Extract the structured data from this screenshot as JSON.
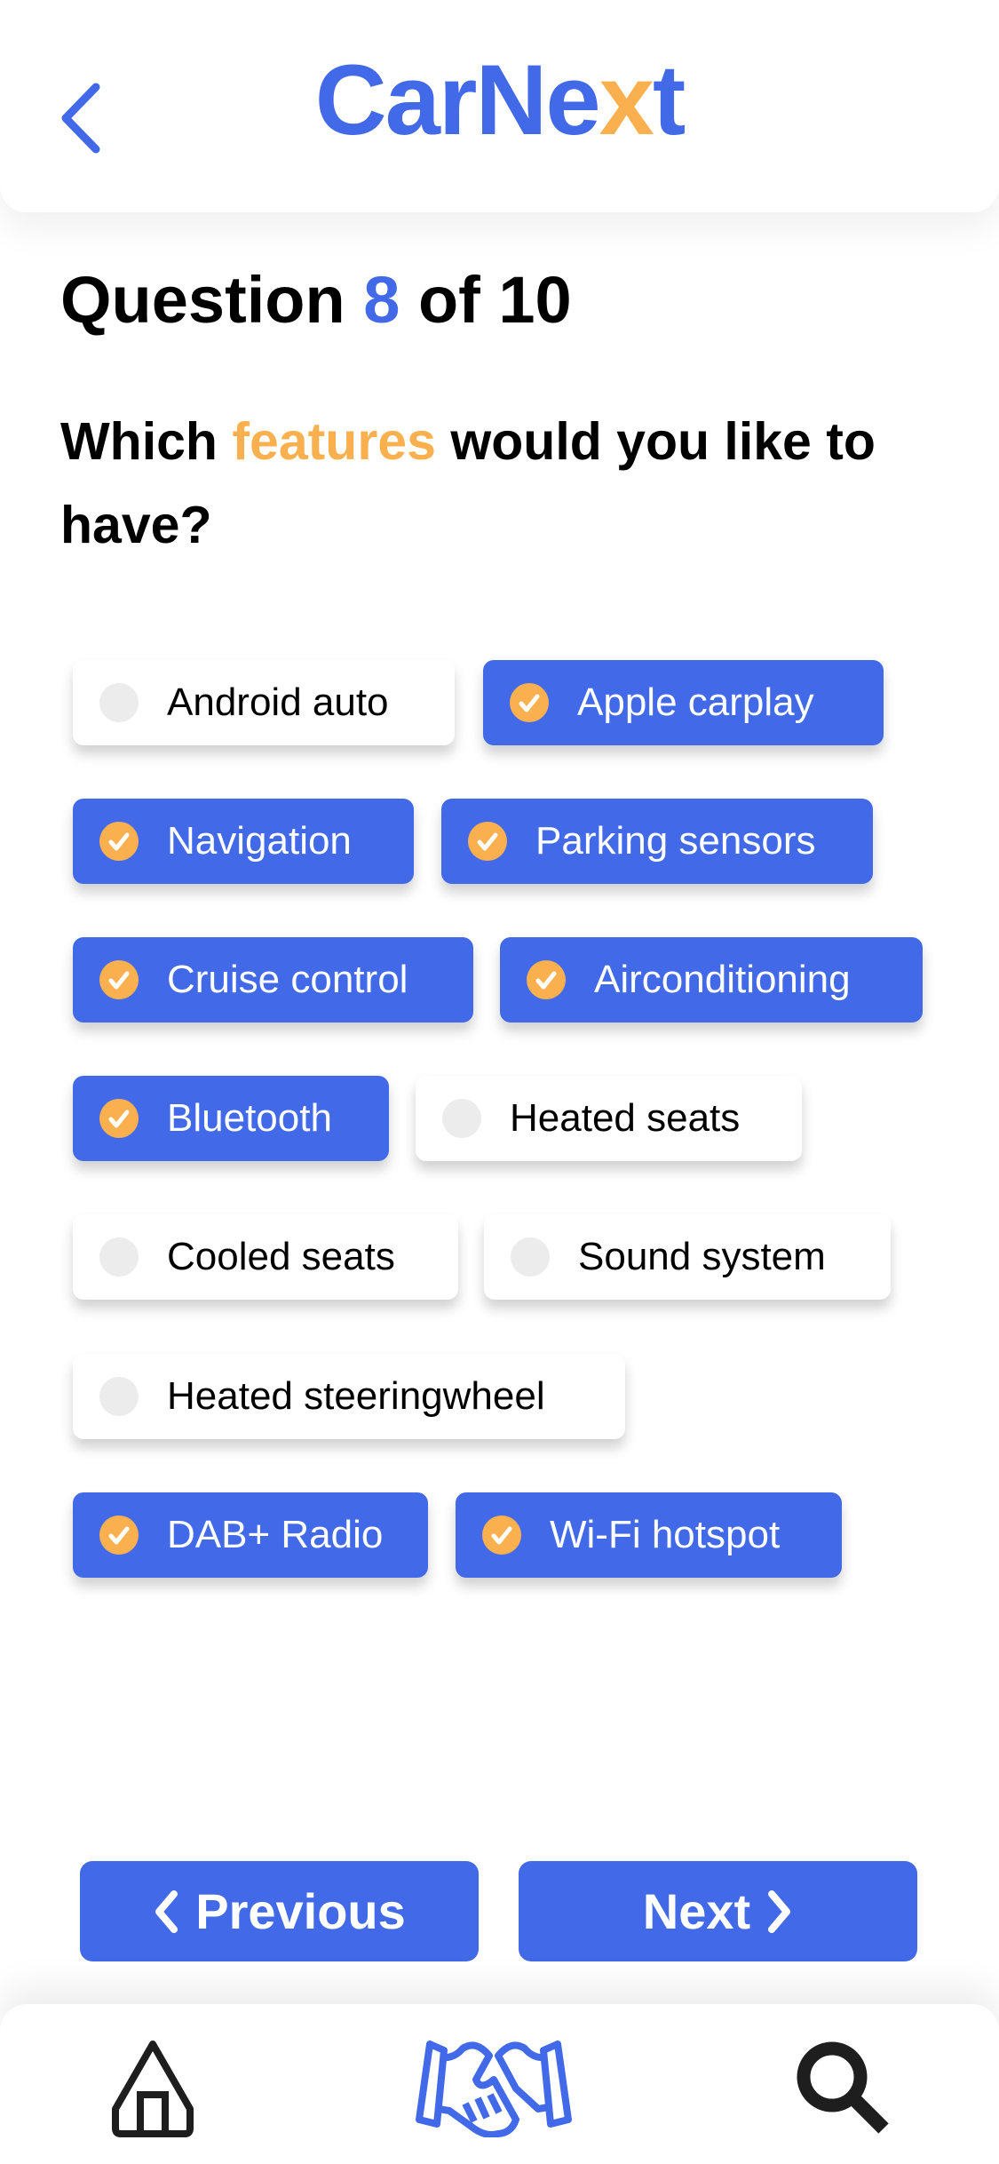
{
  "header": {
    "logo_main": "CarNe",
    "logo_x": "x",
    "logo_end": "t",
    "back_icon": "chevron-left-icon"
  },
  "question": {
    "prefix": "Question",
    "current": "8",
    "middle": "of",
    "total": "10"
  },
  "prompt": {
    "before": "Which",
    "highlight": "features",
    "after": "would you like to have?"
  },
  "options": [
    {
      "label": "Android auto",
      "selected": false
    },
    {
      "label": "Apple carplay",
      "selected": true
    },
    {
      "label": "Navigation",
      "selected": true
    },
    {
      "label": "Parking sensors",
      "selected": true
    },
    {
      "label": "Cruise control",
      "selected": true
    },
    {
      "label": "Airconditioning",
      "selected": true
    },
    {
      "label": "Bluetooth",
      "selected": true
    },
    {
      "label": "Heated seats",
      "selected": false
    },
    {
      "label": "Cooled seats",
      "selected": false
    },
    {
      "label": "Sound system",
      "selected": false
    },
    {
      "label": "Heated steeringwheel",
      "selected": false
    },
    {
      "label": "DAB+ Radio",
      "selected": true
    },
    {
      "label": "Wi-Fi hotspot",
      "selected": true
    }
  ],
  "buttons": {
    "previous": "Previous",
    "next": "Next"
  },
  "bottom_nav": [
    {
      "icon": "home-icon"
    },
    {
      "icon": "handshake-icon",
      "active": true
    },
    {
      "icon": "search-icon"
    }
  ],
  "colors": {
    "primary": "#4169E8",
    "accent": "#FBB04F"
  }
}
